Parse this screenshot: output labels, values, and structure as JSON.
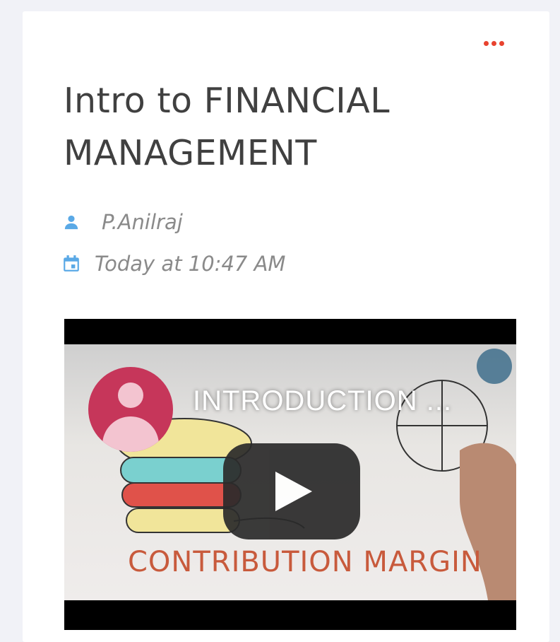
{
  "post": {
    "title": "Intro to FINANCIAL MANAGEMENT",
    "author": "P.Anilraj",
    "timestamp": "Today at 10:47 AM",
    "menu_icon": "more-dots-icon",
    "author_icon": "person-icon",
    "date_icon": "calendar-icon"
  },
  "video": {
    "title": "INTRODUCTION ...",
    "channel_icon": "channel-avatar-icon",
    "play_icon": "play-icon",
    "frame_caption": "CONTRIBUTION MARGIN"
  },
  "colors": {
    "accent_red": "#e8432f",
    "icon_blue": "#5aa9e6",
    "title_text": "#404040",
    "meta_text": "#8a8a8a"
  }
}
